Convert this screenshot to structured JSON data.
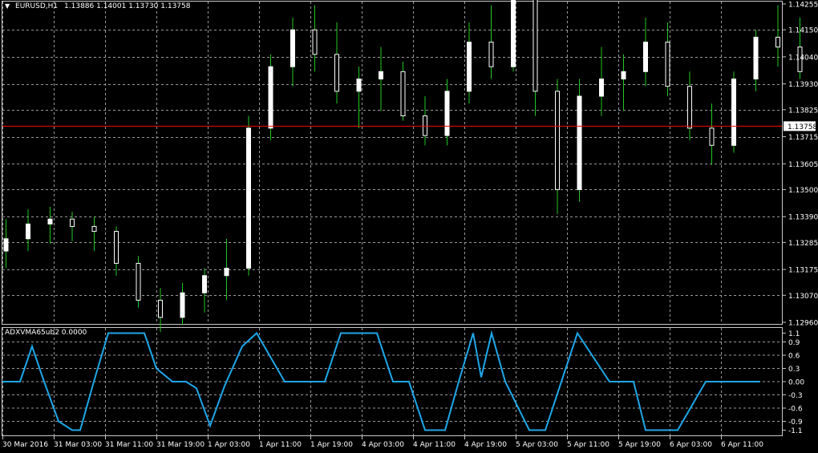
{
  "header": {
    "symbol": "EURUSD,H1",
    "ohlc": "1.13886 1.14001 1.13730 1.13758"
  },
  "indicator": {
    "label": "ADXVMA65ub2 0.0000"
  },
  "colors": {
    "background": "#000000",
    "grid": "#9a9a9a",
    "bull_body": "#ffffff",
    "bear_body": "#ffffff",
    "wick": "#22c722",
    "price_line": "#ff0000",
    "price_tag_bg": "#ffffff",
    "indicator_line": "#1ea7e8"
  },
  "price_axis": {
    "min": 1.1296,
    "max": 1.14255,
    "ticks": [
      "1.14255",
      "1.14150",
      "1.14040",
      "1.13930",
      "1.13825",
      "1.13715",
      "1.13605",
      "1.13500",
      "1.13390",
      "1.13285",
      "1.13175",
      "1.13070",
      "1.12960"
    ],
    "current": "1.13758"
  },
  "indicator_axis": {
    "ticks": [
      "1.1",
      "0.9",
      "0.6",
      "0.3",
      "0.00",
      "-0.3",
      "-0.6",
      "-0.9",
      "-1.1"
    ]
  },
  "time_axis": {
    "labels": [
      "30 Mar 2016",
      "31 Mar 03:00",
      "31 Mar 11:00",
      "31 Mar 19:00",
      "1 Apr 03:00",
      "1 Apr 11:00",
      "1 Apr 19:00",
      "4 Apr 03:00",
      "4 Apr 11:00",
      "4 Apr 19:00",
      "5 Apr 03:00",
      "5 Apr 11:00",
      "5 Apr 19:00",
      "6 Apr 03:00",
      "6 Apr 11:00"
    ]
  },
  "chart_data": {
    "type": "candlestick",
    "ylim": [
      1.1296,
      1.14255
    ],
    "candles": [
      [
        1.1325,
        1.1338,
        1.1318,
        1.133
      ],
      [
        1.133,
        1.1342,
        1.1325,
        1.1336
      ],
      [
        1.1336,
        1.1343,
        1.1328,
        1.1338
      ],
      [
        1.1338,
        1.1341,
        1.1329,
        1.1335
      ],
      [
        1.1335,
        1.1339,
        1.1325,
        1.1333
      ],
      [
        1.1333,
        1.1335,
        1.1315,
        1.132
      ],
      [
        1.132,
        1.1323,
        1.1302,
        1.1305
      ],
      [
        1.1305,
        1.131,
        1.1292,
        1.1298
      ],
      [
        1.1298,
        1.1312,
        1.1295,
        1.1308
      ],
      [
        1.1308,
        1.1318,
        1.13,
        1.1315
      ],
      [
        1.1315,
        1.133,
        1.1305,
        1.1318
      ],
      [
        1.1318,
        1.138,
        1.1315,
        1.1375
      ],
      [
        1.1375,
        1.1405,
        1.137,
        1.14
      ],
      [
        1.14,
        1.142,
        1.1392,
        1.1415
      ],
      [
        1.1415,
        1.1425,
        1.1398,
        1.1405
      ],
      [
        1.1405,
        1.1418,
        1.1385,
        1.139
      ],
      [
        1.139,
        1.14,
        1.1375,
        1.1395
      ],
      [
        1.1395,
        1.1408,
        1.1382,
        1.1398
      ],
      [
        1.1398,
        1.1402,
        1.1378,
        1.138
      ],
      [
        1.138,
        1.1388,
        1.1368,
        1.1372
      ],
      [
        1.1372,
        1.1395,
        1.1368,
        1.139
      ],
      [
        1.139,
        1.1418,
        1.1385,
        1.141
      ],
      [
        1.141,
        1.1425,
        1.1395,
        1.14
      ],
      [
        1.14,
        1.143,
        1.1398,
        1.1428
      ],
      [
        1.1428,
        1.144,
        1.138,
        1.139
      ],
      [
        1.139,
        1.1395,
        1.134,
        1.135
      ],
      [
        1.135,
        1.1395,
        1.1345,
        1.1388
      ],
      [
        1.1388,
        1.1408,
        1.138,
        1.1395
      ],
      [
        1.1395,
        1.1405,
        1.1382,
        1.1398
      ],
      [
        1.1398,
        1.142,
        1.1392,
        1.141
      ],
      [
        1.141,
        1.1418,
        1.1388,
        1.1392
      ],
      [
        1.1392,
        1.1398,
        1.137,
        1.1375
      ],
      [
        1.1375,
        1.1385,
        1.136,
        1.1368
      ],
      [
        1.1368,
        1.1398,
        1.1365,
        1.1395
      ],
      [
        1.1395,
        1.1415,
        1.139,
        1.1412
      ],
      [
        1.1412,
        1.1425,
        1.14,
        1.1408
      ],
      [
        1.1408,
        1.142,
        1.1395,
        1.1398
      ]
    ],
    "indicator_values": [
      0.0,
      0.0,
      0.8,
      0.0,
      -0.9,
      -1.1,
      -1.1,
      0.0,
      1.1,
      1.1,
      1.1,
      0.3,
      0.0,
      0.0,
      -0.15,
      -1.0,
      -0.1,
      0.8,
      1.1,
      0.0,
      0.0,
      0.0,
      1.1,
      1.1,
      0.0,
      0.0,
      -1.1,
      -1.1,
      0.0,
      1.1,
      0.1,
      1.1,
      0.0,
      -1.1,
      -1.1,
      0.0,
      1.1,
      0.0,
      0.0,
      -1.1,
      -1.1,
      0.0,
      0.0
    ]
  }
}
